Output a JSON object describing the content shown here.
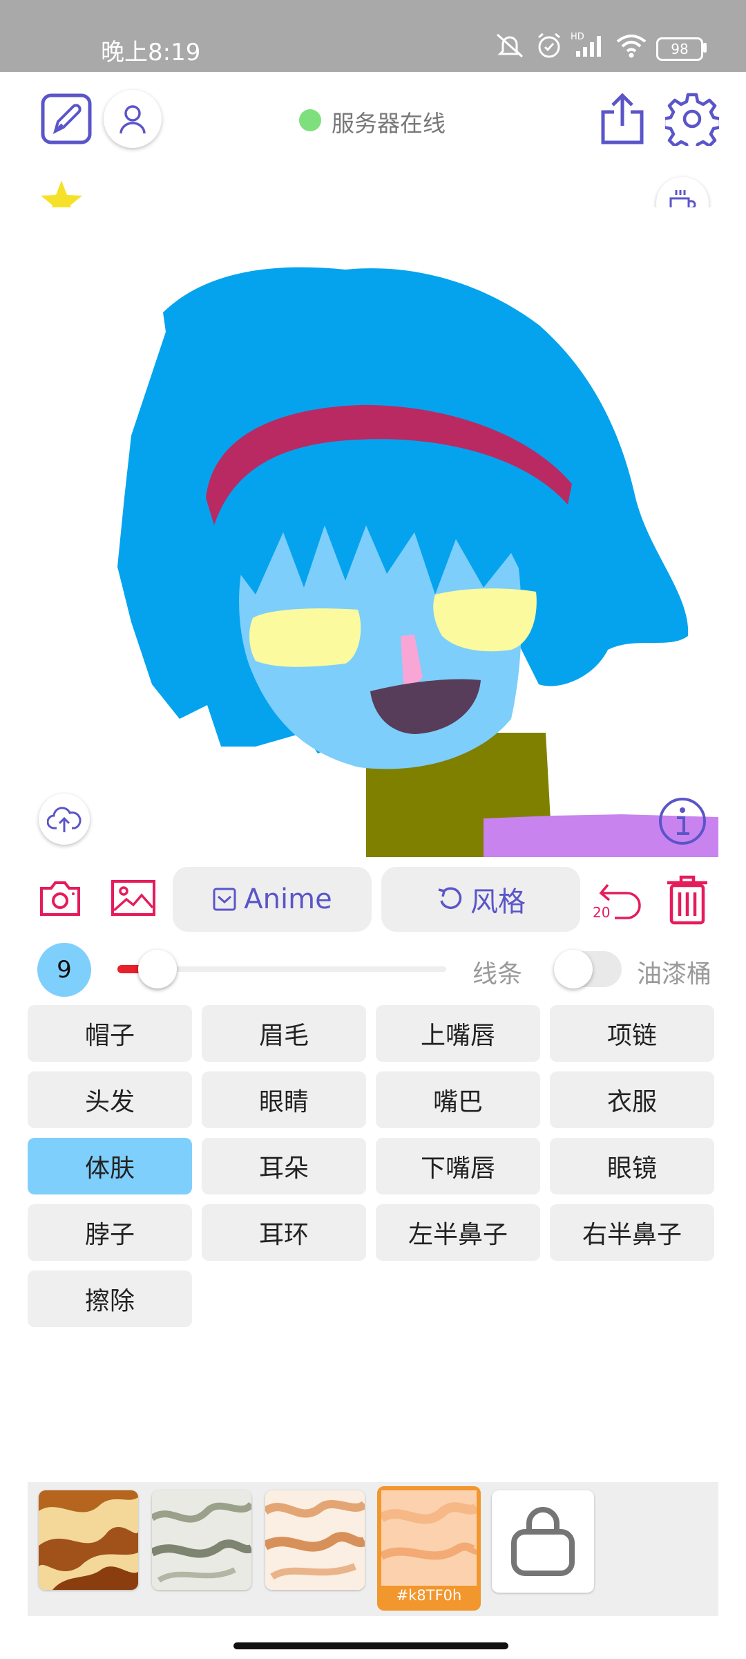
{
  "status_bar": {
    "time": "晚上8:19",
    "battery": "98",
    "net_label": "HD"
  },
  "header": {
    "server_status": "服务器在线",
    "server_color": "#7de07d"
  },
  "toolbar": {
    "anime_label": "Anime",
    "style_label": "风格",
    "undo_count": "20"
  },
  "slider": {
    "size_value": "9",
    "size_fraction": 0.09,
    "lines_label": "线条",
    "bucket_label": "油漆桶",
    "bucket_enabled": false
  },
  "parts": [
    {
      "label": "帽子"
    },
    {
      "label": "眉毛"
    },
    {
      "label": "上嘴唇"
    },
    {
      "label": "项链"
    },
    {
      "label": "头发"
    },
    {
      "label": "眼睛"
    },
    {
      "label": "嘴巴"
    },
    {
      "label": "衣服"
    },
    {
      "label": "体肤"
    },
    {
      "label": "耳朵"
    },
    {
      "label": "下嘴唇"
    },
    {
      "label": "眼镜"
    },
    {
      "label": "脖子"
    },
    {
      "label": "耳环"
    },
    {
      "label": "左半鼻子"
    },
    {
      "label": "右半鼻子"
    },
    {
      "label": "擦除"
    }
  ],
  "selected_part": "体肤",
  "swatches": {
    "selected_code": "#k8TF0h"
  },
  "colors": {
    "accent": "#5a55c9",
    "red": "#e51c5b",
    "selected_blue": "#7fcffd",
    "selected_swatch": "#f2962e"
  }
}
